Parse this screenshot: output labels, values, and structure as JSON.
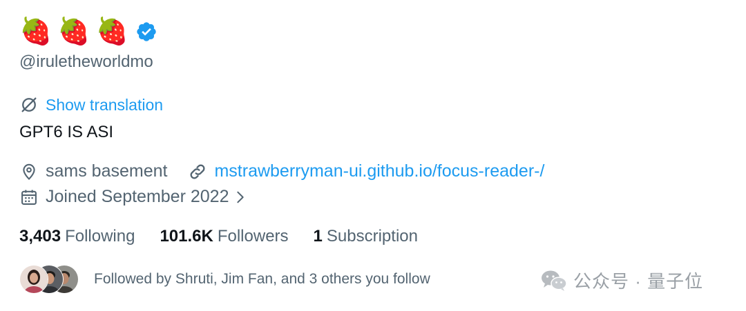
{
  "profile": {
    "display_name_emojis": [
      "🍓",
      "🍓",
      "🍓"
    ],
    "verified_badge_icon": "verified-badge-icon",
    "handle": "@iruletheworldmo",
    "show_translation": "Show translation",
    "bio": "GPT6 IS ASI",
    "location": "sams basement",
    "website": "mstrawberryman-ui.github.io/focus-reader-/",
    "joined": "Joined September 2022",
    "stats": {
      "following_count": "3,403",
      "following_label": "Following",
      "followers_count": "101.6K",
      "followers_label": "Followers",
      "subscription_count": "1",
      "subscription_label": "Subscription"
    },
    "followed_by": "Followed by Shruti, Jim Fan, and 3 others you follow"
  },
  "watermark": {
    "text": "公众号 · 量子位"
  },
  "colors": {
    "accent": "#1d9bf0",
    "secondary_text": "#536471",
    "primary_text": "#0f1419",
    "verified": "#1d9bf0",
    "watermark": "#9aa0a6"
  }
}
